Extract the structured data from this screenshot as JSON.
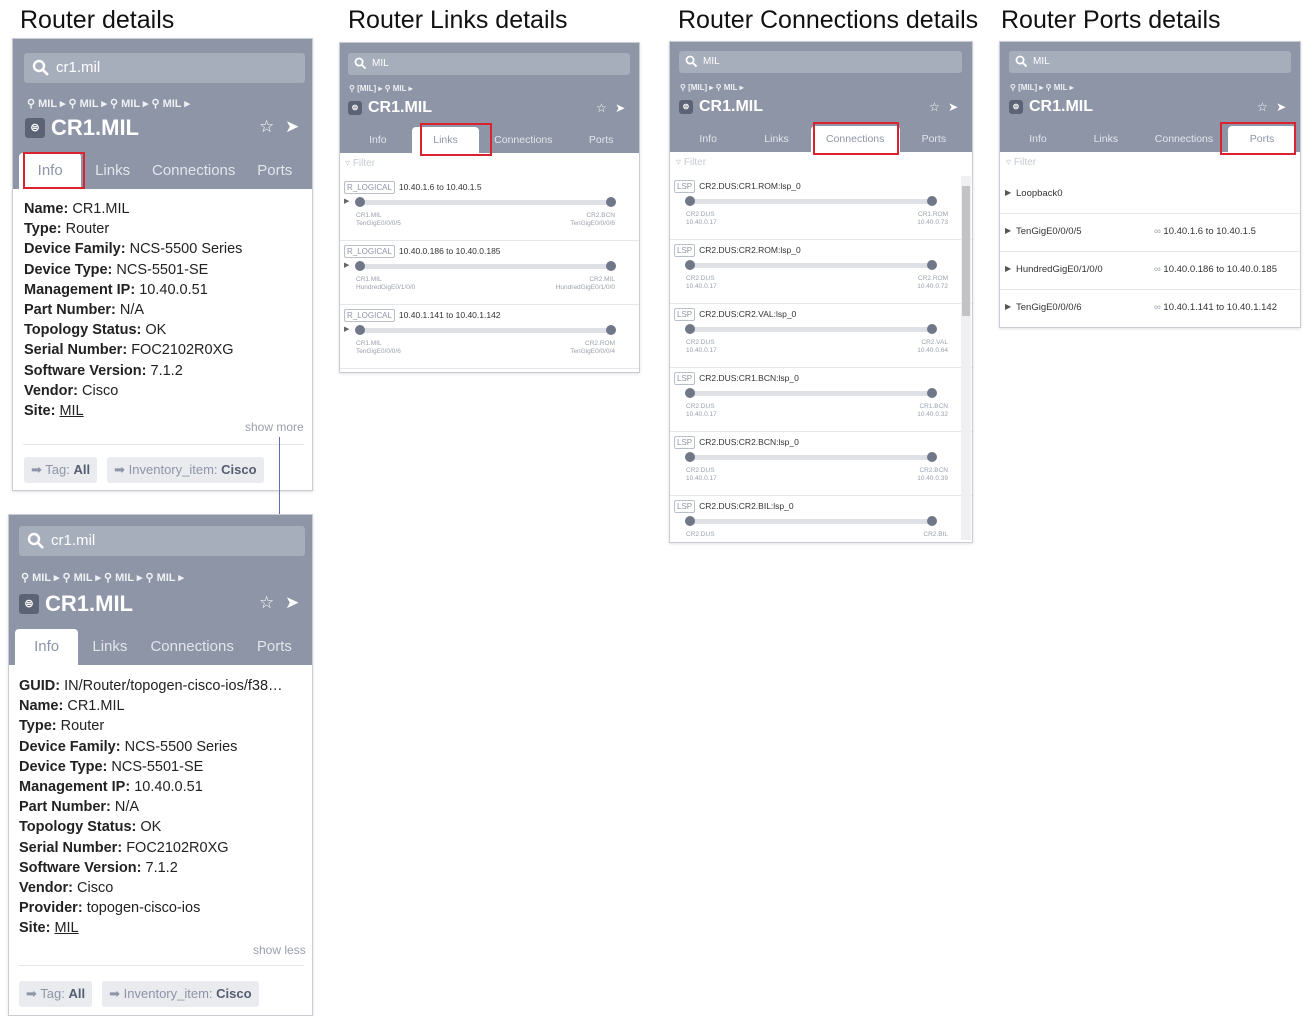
{
  "section_titles": {
    "router": "Router details",
    "links": "Router Links details",
    "connections": "Router Connections details",
    "ports": "Router Ports details"
  },
  "panel1": {
    "search": "cr1.mil",
    "crumb": "MIL ▸ ⚲ MIL ▸ ⚲ MIL ▸ ⚲ MIL ▸",
    "title": "CR1.MIL",
    "tabs": [
      "Info",
      "Links",
      "Connections",
      "Ports"
    ],
    "fields": [
      {
        "k": "Name:",
        "v": "CR1.MIL"
      },
      {
        "k": "Type:",
        "v": "Router"
      },
      {
        "k": "Device Family:",
        "v": "NCS-5500 Series"
      },
      {
        "k": "Device Type:",
        "v": "NCS-5501-SE"
      },
      {
        "k": "Management IP:",
        "v": "10.40.0.51"
      },
      {
        "k": "Part Number:",
        "v": "N/A"
      },
      {
        "k": "Topology Status:",
        "v": "OK"
      },
      {
        "k": "Serial Number:",
        "v": "FOC2102R0XG"
      },
      {
        "k": "Software Version:",
        "v": "7.1.2"
      },
      {
        "k": "Vendor:",
        "v": "Cisco"
      },
      {
        "k": "Site:",
        "v": "MIL"
      }
    ],
    "show_more": "show more",
    "tag1_k": "Tag:",
    "tag1_v": "All",
    "tag2_k": "Inventory_item:",
    "tag2_v": "Cisco"
  },
  "panel2": {
    "search": "cr1.mil",
    "crumb": "MIL ▸ ⚲ MIL ▸ ⚲ MIL ▸ ⚲ MIL ▸",
    "title": "CR1.MIL",
    "tabs": [
      "Info",
      "Links",
      "Connections",
      "Ports"
    ],
    "fields": [
      {
        "k": "GUID:",
        "v": "IN/Router/topogen-cisco-ios/f38…"
      },
      {
        "k": "Name:",
        "v": "CR1.MIL"
      },
      {
        "k": "Type:",
        "v": "Router"
      },
      {
        "k": "Device Family:",
        "v": "NCS-5500 Series"
      },
      {
        "k": "Device Type:",
        "v": "NCS-5501-SE"
      },
      {
        "k": "Management IP:",
        "v": "10.40.0.51"
      },
      {
        "k": "Part Number:",
        "v": "N/A"
      },
      {
        "k": "Topology Status:",
        "v": "OK"
      },
      {
        "k": "Serial Number:",
        "v": "FOC2102R0XG"
      },
      {
        "k": "Software Version:",
        "v": "7.1.2"
      },
      {
        "k": "Vendor:",
        "v": "Cisco"
      },
      {
        "k": "Provider:",
        "v": "topogen-cisco-ios"
      },
      {
        "k": "Site:",
        "v": "MIL"
      }
    ],
    "show_less": "show less",
    "tag1_k": "Tag:",
    "tag1_v": "All",
    "tag2_k": "Inventory_item:",
    "tag2_v": "Cisco"
  },
  "links_panel": {
    "search": "MIL",
    "crumb": "[MIL] ▸ ⚲ MIL ▸",
    "title": "CR1.MIL",
    "tabs": [
      "Info",
      "Links",
      "Connections",
      "Ports"
    ],
    "filter": "Filter",
    "items": [
      {
        "chip": "R_LOGICAL",
        "title": "10.40.1.6 to 10.40.1.5",
        "l1": "CR1.MIL",
        "l2": "TenGigE0/0/0/5",
        "r1": "CR2.BCN",
        "r2": "TenGigE0/0/0/6"
      },
      {
        "chip": "R_LOGICAL",
        "title": "10.40.0.186 to 10.40.0.185",
        "l1": "CR1.MIL",
        "l2": "HundredGigE0/1/0/0",
        "r1": "CR2.MIL",
        "r2": "HundredGigE0/1/0/0"
      },
      {
        "chip": "R_LOGICAL",
        "title": "10.40.1.141 to 10.40.1.142",
        "l1": "CR1.MIL",
        "l2": "TenGigE0/0/0/6",
        "r1": "CR2.ROM",
        "r2": "TenGigE0/0/0/4"
      }
    ]
  },
  "conn_panel": {
    "search": "MIL",
    "crumb": "[MIL] ▸ ⚲ MIL ▸",
    "title": "CR1.MIL",
    "tabs": [
      "Info",
      "Links",
      "Connections",
      "Ports"
    ],
    "filter": "Filter",
    "items": [
      {
        "chip": "LSP",
        "title": "CR2.DUS:CR1.ROM:lsp_0",
        "l1": "CR2.DUS",
        "l2": "10.40.0.17",
        "r1": "CR1.ROM",
        "r2": "10.40.0.73"
      },
      {
        "chip": "LSP",
        "title": "CR2.DUS:CR2.ROM:lsp_0",
        "l1": "CR2.DUS",
        "l2": "10.40.0.17",
        "r1": "CR2.ROM",
        "r2": "10.40.0.72"
      },
      {
        "chip": "LSP",
        "title": "CR2.DUS:CR2.VAL:lsp_0",
        "l1": "CR2.DUS",
        "l2": "10.40.0.17",
        "r1": "CR2.VAL",
        "r2": "10.40.0.64"
      },
      {
        "chip": "LSP",
        "title": "CR2.DUS:CR1.BCN:lsp_0",
        "l1": "CR2.DUS",
        "l2": "10.40.0.17",
        "r1": "CR1.BCN",
        "r2": "10.40.0.32"
      },
      {
        "chip": "LSP",
        "title": "CR2.DUS:CR2.BCN:lsp_0",
        "l1": "CR2.DUS",
        "l2": "10.40.0.17",
        "r1": "CR2.BCN",
        "r2": "10.40.0.39"
      },
      {
        "chip": "LSP",
        "title": "CR2.DUS:CR2.BIL:lsp_0",
        "l1": "CR2.DUS",
        "l2": "",
        "r1": "CR2.BIL",
        "r2": ""
      }
    ]
  },
  "ports_panel": {
    "search": "MIL",
    "crumb": "[MIL] ▸ ⚲ MIL ▸",
    "title": "CR1.MIL",
    "tabs": [
      "Info",
      "Links",
      "Connections",
      "Ports"
    ],
    "filter": "Filter",
    "ports": [
      {
        "name": "Loopback0",
        "link": ""
      },
      {
        "name": "TenGigE0/0/0/5",
        "link": "10.40.1.6 to 10.40.1.5"
      },
      {
        "name": "HundredGigE0/1/0/0",
        "link": "10.40.0.186 to 10.40.0.185"
      },
      {
        "name": "TenGigE0/0/0/6",
        "link": "10.40.1.141 to 10.40.1.142"
      }
    ]
  }
}
